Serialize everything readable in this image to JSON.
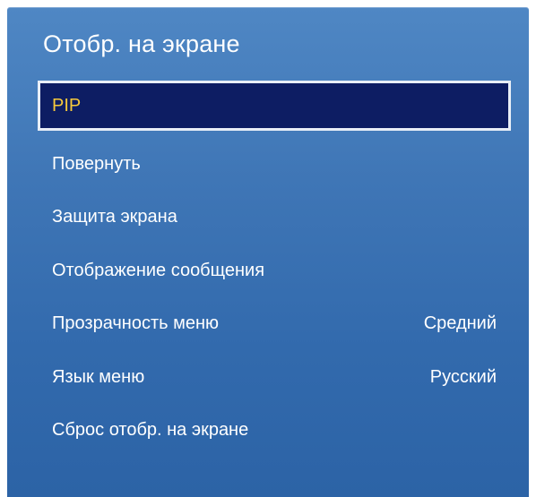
{
  "menu": {
    "title": "Отобр. на экране",
    "items": [
      {
        "label": "PIP",
        "value": "",
        "selected": true
      },
      {
        "label": "Повернуть",
        "value": ""
      },
      {
        "label": "Защита экрана",
        "value": ""
      },
      {
        "label": "Отображение сообщения",
        "value": ""
      },
      {
        "label": "Прозрачность меню",
        "value": "Средний"
      },
      {
        "label": "Язык меню",
        "value": "Русский"
      },
      {
        "label": "Сброс отобр. на экране",
        "value": ""
      }
    ]
  },
  "colors": {
    "panel_blue": "#3f76b6",
    "selected_bg": "#0d1d63",
    "selected_text": "#f7c93b",
    "text": "#ffffff"
  }
}
